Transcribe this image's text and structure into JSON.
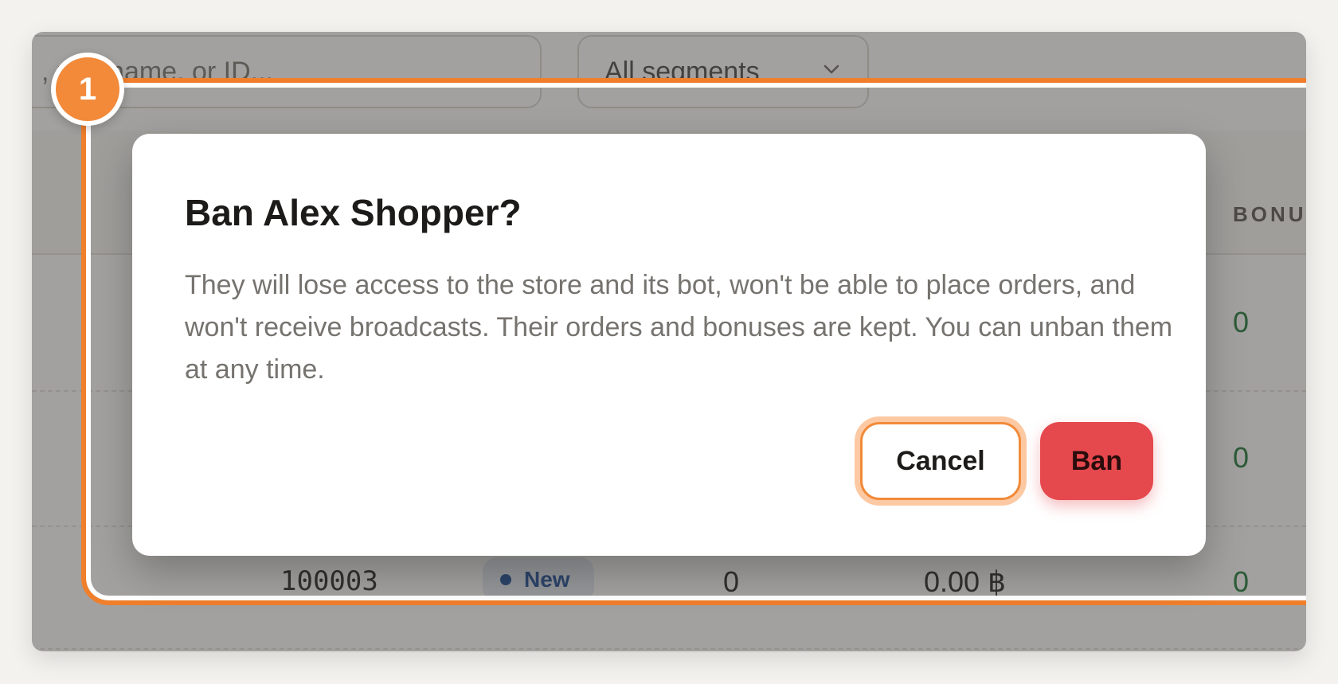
{
  "background_page": {
    "search_placeholder_visible": ", username, or ID...",
    "segment_select": {
      "value": "All segments",
      "icon": "chevron-down-icon"
    },
    "table": {
      "bonus_column_header": "BONU",
      "rows": [
        {
          "bonus": "0"
        },
        {
          "bonus": "0"
        },
        {
          "id": "100003",
          "status": "New",
          "orders": "0",
          "spent": "0.00 ฿",
          "bonus": "0"
        }
      ]
    }
  },
  "annotation": {
    "step_number": "1",
    "highlight_color": "#f07f2c"
  },
  "modal": {
    "title": "Ban Alex Shopper?",
    "body": "They will lose access to the store and its bot, won't be able to place orders, and won't receive broadcasts. Their orders and bonuses are kept. You can unban them at any time.",
    "cancel_label": "Cancel",
    "confirm_label": "Ban",
    "confirm_color": "#e5484d"
  }
}
